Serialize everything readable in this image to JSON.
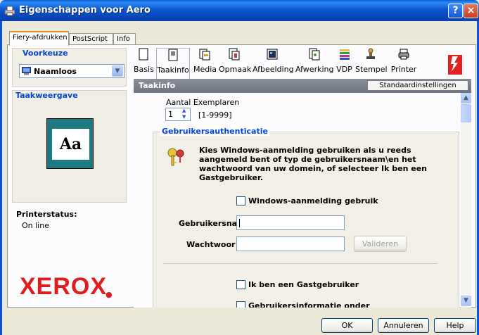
{
  "window": {
    "title": "Eigenschappen voor Aero",
    "help_btn": "?",
    "close_btn": "×"
  },
  "top_tabs": [
    "Fiery-afdrukken",
    "PostScript",
    "Info"
  ],
  "left": {
    "preset_title": "Voorkeuze",
    "preset_value": "Naamloos",
    "view_title": "Taakweergave",
    "preview_text": "Aa",
    "printer_status_label": "Printerstatus:",
    "printer_status_value": "On line",
    "brand": "XEROX"
  },
  "toolbar": [
    {
      "label": "Basis",
      "icon": "page-icon"
    },
    {
      "label": "Taakinfo",
      "icon": "page-info-icon"
    },
    {
      "label": "Media",
      "icon": "media-icon"
    },
    {
      "label": "Opmaak",
      "icon": "layout-icon"
    },
    {
      "label": "Afbeelding",
      "icon": "image-icon"
    },
    {
      "label": "Afwerking",
      "icon": "finishing-icon"
    },
    {
      "label": "VDP",
      "icon": "vdp-icon"
    },
    {
      "label": "Stempel",
      "icon": "stamp-icon"
    },
    {
      "label": "Printer",
      "icon": "printer-icon"
    }
  ],
  "section": {
    "title": "Taakinfo",
    "defaults_button": "Standaardinstellingen"
  },
  "copies": {
    "label": "Aantal Exemplaren",
    "value": "1",
    "range": "[1-9999]"
  },
  "auth": {
    "title": "Gebruikersauthenticatie",
    "description_1": "Kies Windows-aanmelding gebruiken als u reeds",
    "description_2": "aangemeld bent of typ de gebruikersnaam\\en het",
    "description_3": "wachtwoord van uw domein, of selecteer Ik ben een",
    "description_4": "Gastgebruiker.",
    "windows_login": "Windows-aanmelding gebruik",
    "username_label": "Gebruikersnaa",
    "password_label": "Wachtwoor",
    "validate_button": "Valideren",
    "guest": "Ik ben een Gastgebruiker",
    "next_partial": "Gebruikersinformatie onder"
  },
  "footer": {
    "ok": "OK",
    "cancel": "Annuleren",
    "help": "Help"
  }
}
